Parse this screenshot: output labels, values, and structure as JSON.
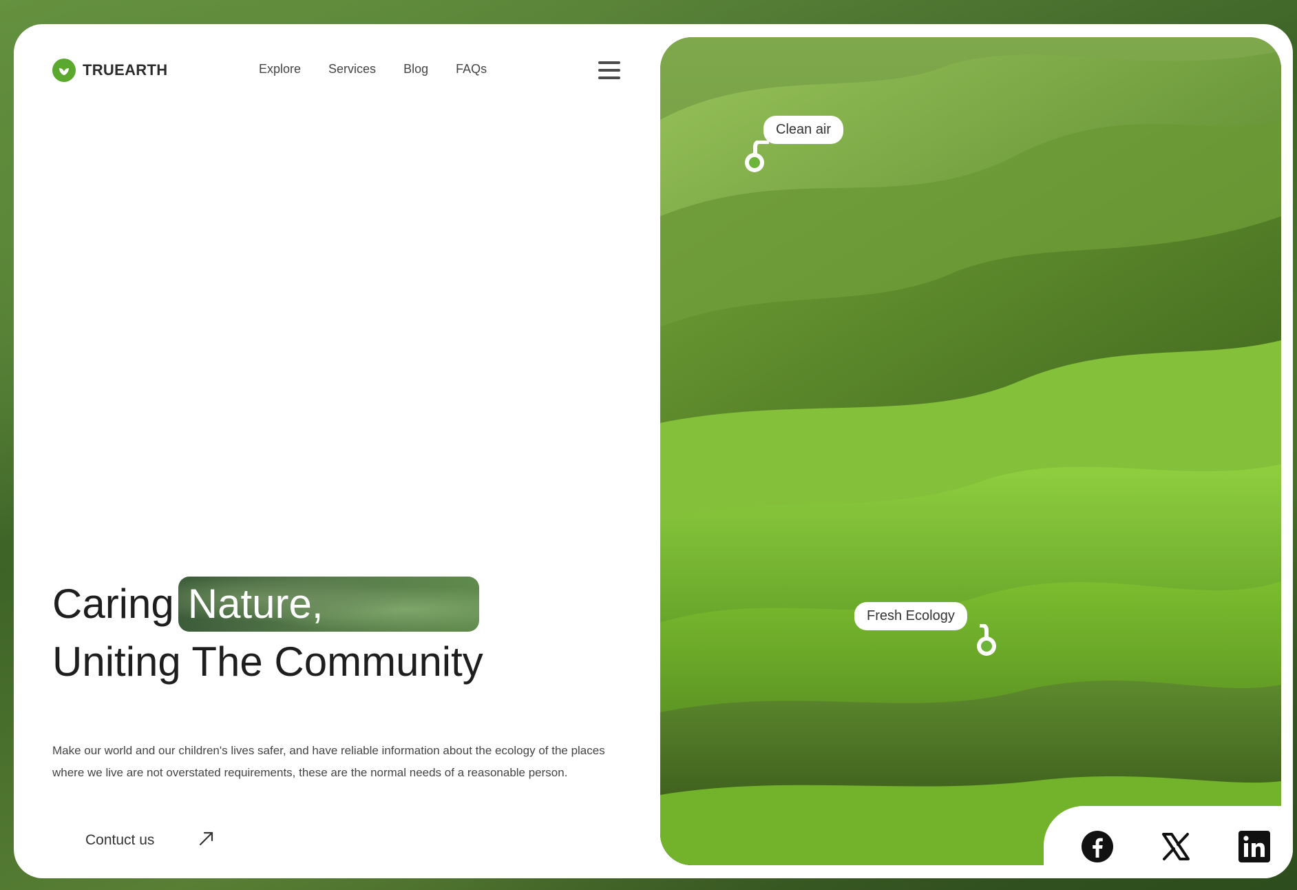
{
  "brand": {
    "name": "TRUEARTH",
    "accent": "#5aa82d"
  },
  "nav": {
    "items": [
      "Explore",
      "Services",
      "Blog",
      "FAQs"
    ]
  },
  "menu": {
    "icon": "hamburger-menu-icon"
  },
  "hero": {
    "headline_word1": "Caring",
    "headline_highlight": "Nature,",
    "headline_line2": "Uniting The Community",
    "description": "Make our world and our children's lives safer, and have reliable information about the ecology of the places where we live are not overstated requirements, these are the normal needs of a reasonable person.",
    "cta_label": "Contuct us",
    "cta_icon": "arrow-up-right-icon"
  },
  "photo": {
    "tags": [
      "Clean air",
      "Fresh Ecology"
    ],
    "marker_color": "#6cb43a"
  },
  "social": {
    "icons": [
      "facebook-icon",
      "x-icon",
      "linkedin-icon"
    ]
  }
}
